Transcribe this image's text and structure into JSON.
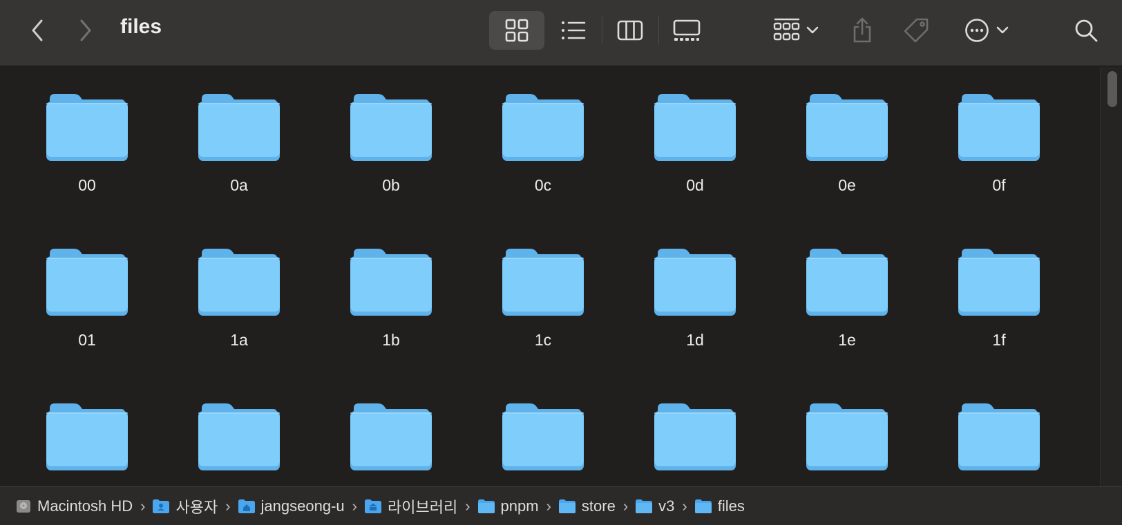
{
  "window": {
    "title": "files"
  },
  "colors": {
    "folder": "#7ecdfa",
    "folder_dark": "#5fb2ea",
    "background": "#211f1e",
    "toolbar": "#373534"
  },
  "toolbar": {
    "view_modes": [
      {
        "name": "icon-view",
        "icon": "grid-icon",
        "active": true
      },
      {
        "name": "list-view",
        "icon": "list-icon",
        "active": false
      },
      {
        "name": "column-view",
        "icon": "columns-icon",
        "active": false
      },
      {
        "name": "gallery-view",
        "icon": "gallery-icon",
        "active": false
      }
    ],
    "actions": [
      "group-icon",
      "share-icon",
      "tag-icon",
      "more-icon",
      "search-icon"
    ]
  },
  "folders": [
    "00",
    "0a",
    "0b",
    "0c",
    "0d",
    "0e",
    "0f",
    "01",
    "1a",
    "1b",
    "1c",
    "1d",
    "1e",
    "1f",
    "",
    "",
    "",
    "",
    "",
    "",
    ""
  ],
  "path": [
    {
      "label": "Macintosh HD",
      "icon": "hard-drive-icon"
    },
    {
      "label": "사용자",
      "icon": "users-folder-icon"
    },
    {
      "label": "jangseong-u",
      "icon": "home-folder-icon"
    },
    {
      "label": "라이브러리",
      "icon": "library-folder-icon"
    },
    {
      "label": "pnpm",
      "icon": "folder-icon"
    },
    {
      "label": "store",
      "icon": "folder-icon"
    },
    {
      "label": "v3",
      "icon": "folder-icon"
    },
    {
      "label": "files",
      "icon": "folder-icon"
    }
  ]
}
